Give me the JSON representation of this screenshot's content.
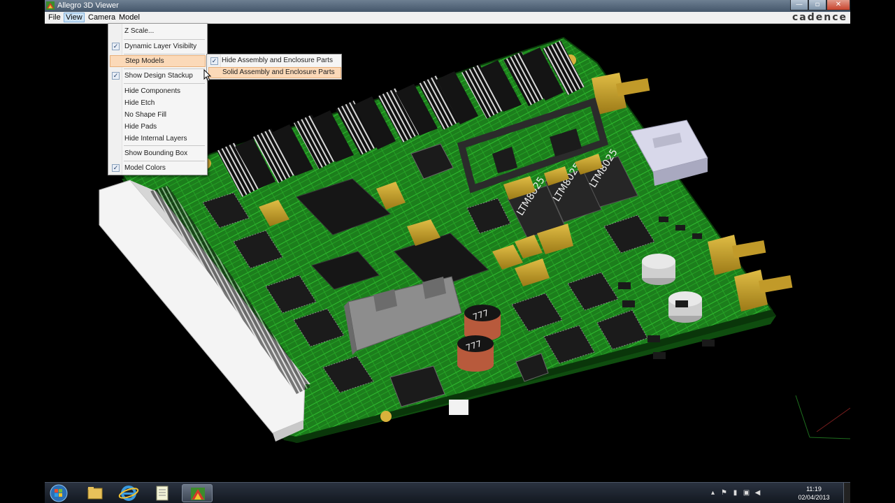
{
  "window": {
    "title": "Allegro 3D Viewer",
    "brand": "cadence",
    "controls": {
      "minimize": "—",
      "maximize": "▫",
      "close": "✕"
    }
  },
  "menubar": {
    "items": [
      {
        "label": "File"
      },
      {
        "label": "View",
        "active": true
      },
      {
        "label": "Camera"
      },
      {
        "label": "Model"
      }
    ]
  },
  "view_menu": {
    "items": [
      {
        "label": "Z Scale...",
        "checked": false
      },
      {
        "label": "Dynamic Layer Visibilty",
        "checked": true
      },
      {
        "label": "Step Models",
        "checked": false,
        "highlighted": true,
        "has_submenu": true
      },
      {
        "label": "Show Design Stackup",
        "checked": true
      },
      {
        "label": "Hide Components",
        "checked": false
      },
      {
        "label": "Hide Etch",
        "checked": false
      },
      {
        "label": "No Shape Fill",
        "checked": false
      },
      {
        "label": "Hide Pads",
        "checked": false
      },
      {
        "label": "Hide Internal Layers",
        "checked": false
      },
      {
        "label": "Show Bounding Box",
        "checked": false
      },
      {
        "label": "Model Colors",
        "checked": true
      }
    ]
  },
  "step_models_submenu": {
    "items": [
      {
        "label": "Hide  Assembly and Enclosure Parts",
        "checked": true
      },
      {
        "label": "Solid Assembly and Enclosure Parts",
        "checked": false,
        "highlighted": true
      }
    ]
  },
  "board": {
    "component_labels": [
      "LTM8025",
      "LTM8025",
      "LTM8025"
    ],
    "inductor_labels": [
      "777",
      "777"
    ]
  },
  "taskbar": {
    "apps": [
      "start-orb",
      "explorer",
      "internet-explorer",
      "notepad",
      "allegro-3d-viewer"
    ],
    "clock": {
      "time": "11:19",
      "date": "02/04/2013"
    }
  },
  "colors": {
    "pcb": "#1f8a1f",
    "trace": "#31c531",
    "ic": "#1a1a1a",
    "gold": "#c9a52a",
    "connector": "#f2f2f2",
    "menu_highlight": "#fbd9b8"
  }
}
